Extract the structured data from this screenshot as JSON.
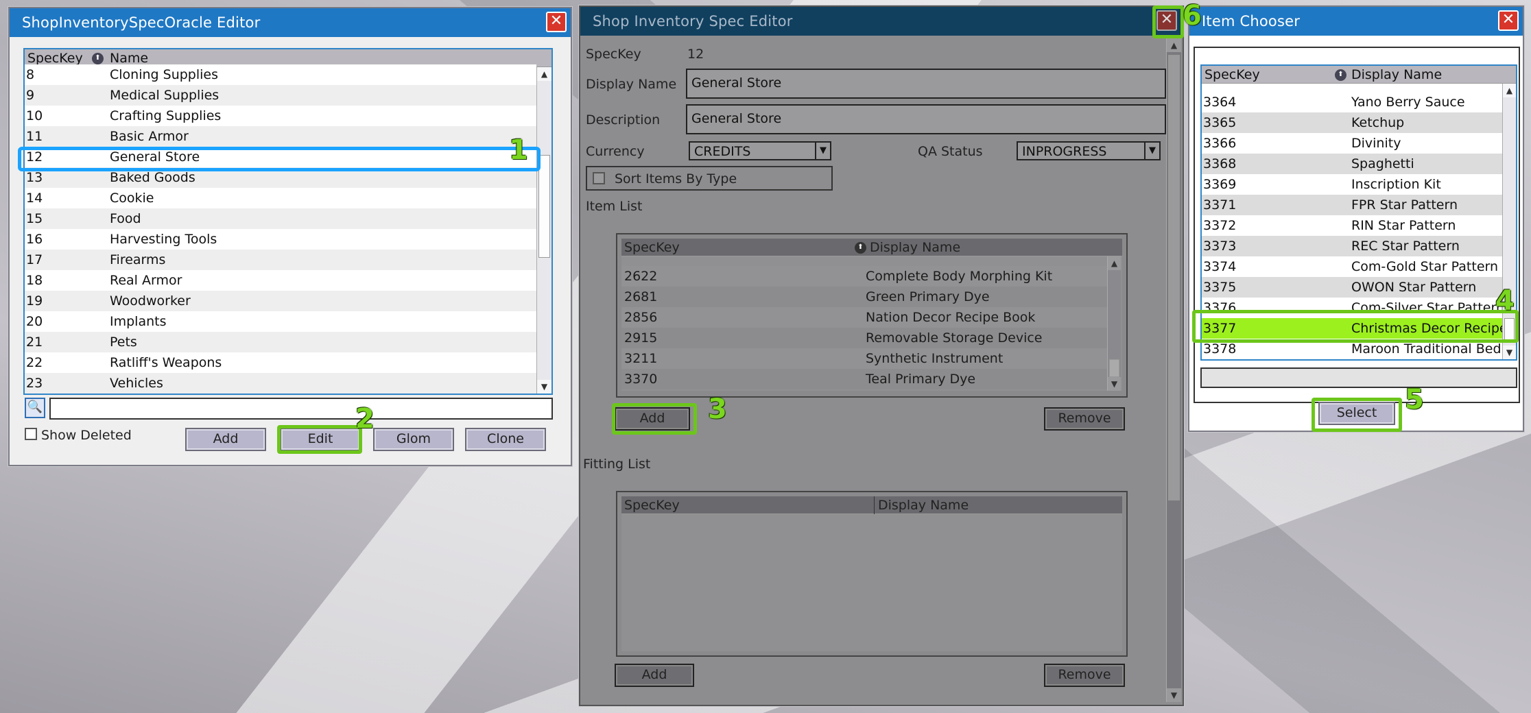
{
  "oracle_editor": {
    "title": "ShopInventorySpecOracle Editor",
    "col_speckey": "SpecKey",
    "col_name": "Name",
    "rows": [
      {
        "key": "8",
        "name": "Cloning Supplies"
      },
      {
        "key": "9",
        "name": "Medical Supplies"
      },
      {
        "key": "10",
        "name": "Crafting Supplies"
      },
      {
        "key": "11",
        "name": "Basic Armor"
      },
      {
        "key": "12",
        "name": "General Store"
      },
      {
        "key": "13",
        "name": "Baked Goods"
      },
      {
        "key": "14",
        "name": "Cookie"
      },
      {
        "key": "15",
        "name": "Food"
      },
      {
        "key": "16",
        "name": "Harvesting Tools"
      },
      {
        "key": "17",
        "name": "Firearms"
      },
      {
        "key": "18",
        "name": "Real Armor"
      },
      {
        "key": "19",
        "name": "Woodworker"
      },
      {
        "key": "20",
        "name": "Implants"
      },
      {
        "key": "21",
        "name": "Pets"
      },
      {
        "key": "22",
        "name": "Ratliff's Weapons"
      },
      {
        "key": "23",
        "name": "Vehicles"
      }
    ],
    "selected_key": "12",
    "search_value": "",
    "show_deleted_label": "Show Deleted",
    "add_label": "Add",
    "edit_label": "Edit",
    "glom_label": "Glom",
    "clone_label": "Clone"
  },
  "spec_editor": {
    "title": "Shop Inventory Spec Editor",
    "speckey_label": "SpecKey",
    "speckey_value": "12",
    "display_name_label": "Display Name",
    "display_name_value": "General Store",
    "description_label": "Description",
    "description_value": "General Store",
    "currency_label": "Currency",
    "currency_value": "CREDITS",
    "qa_status_label": "QA Status",
    "qa_status_value": "INPROGRESS",
    "sort_items_label": "Sort Items By Type",
    "item_list_label": "Item List",
    "col_speckey": "SpecKey",
    "col_display_name": "Display Name",
    "items": [
      {
        "key": "2622",
        "name": "Complete Body Morphing Kit"
      },
      {
        "key": "2681",
        "name": "Green Primary Dye"
      },
      {
        "key": "2856",
        "name": "Nation Decor Recipe Book"
      },
      {
        "key": "2915",
        "name": "Removable Storage Device"
      },
      {
        "key": "3211",
        "name": "Synthetic Instrument"
      },
      {
        "key": "3370",
        "name": "Teal Primary Dye"
      }
    ],
    "item_add_label": "Add",
    "item_remove_label": "Remove",
    "fitting_list_label": "Fitting List",
    "fitting_add_label": "Add",
    "fitting_remove_label": "Remove"
  },
  "item_chooser": {
    "title": "Item Chooser",
    "col_speckey": "SpecKey",
    "col_display_name": "Display Name",
    "rows": [
      {
        "key": "3364",
        "name": "Yano Berry Sauce"
      },
      {
        "key": "3365",
        "name": "Ketchup"
      },
      {
        "key": "3366",
        "name": "Divinity"
      },
      {
        "key": "3368",
        "name": "Spaghetti"
      },
      {
        "key": "3369",
        "name": "Inscription Kit"
      },
      {
        "key": "3371",
        "name": "FPR Star Pattern"
      },
      {
        "key": "3372",
        "name": "RIN Star Pattern"
      },
      {
        "key": "3373",
        "name": "REC Star Pattern"
      },
      {
        "key": "3374",
        "name": "Com-Gold Star Pattern"
      },
      {
        "key": "3375",
        "name": "OWON Star Pattern"
      },
      {
        "key": "3376",
        "name": "Com-Silver Star Pattern"
      },
      {
        "key": "3377",
        "name": "Christmas Decor Recipe"
      },
      {
        "key": "3378",
        "name": "Maroon Traditional Bed"
      }
    ],
    "selected_key": "3377",
    "select_label": "Select"
  },
  "annotations": [
    "1",
    "2",
    "3",
    "4",
    "5",
    "6"
  ],
  "colors": {
    "titlebar": "#1f78c4",
    "highlight": "#6cc61a",
    "selection": "#9cf01e",
    "selection_outline": "#1aa3ff"
  }
}
